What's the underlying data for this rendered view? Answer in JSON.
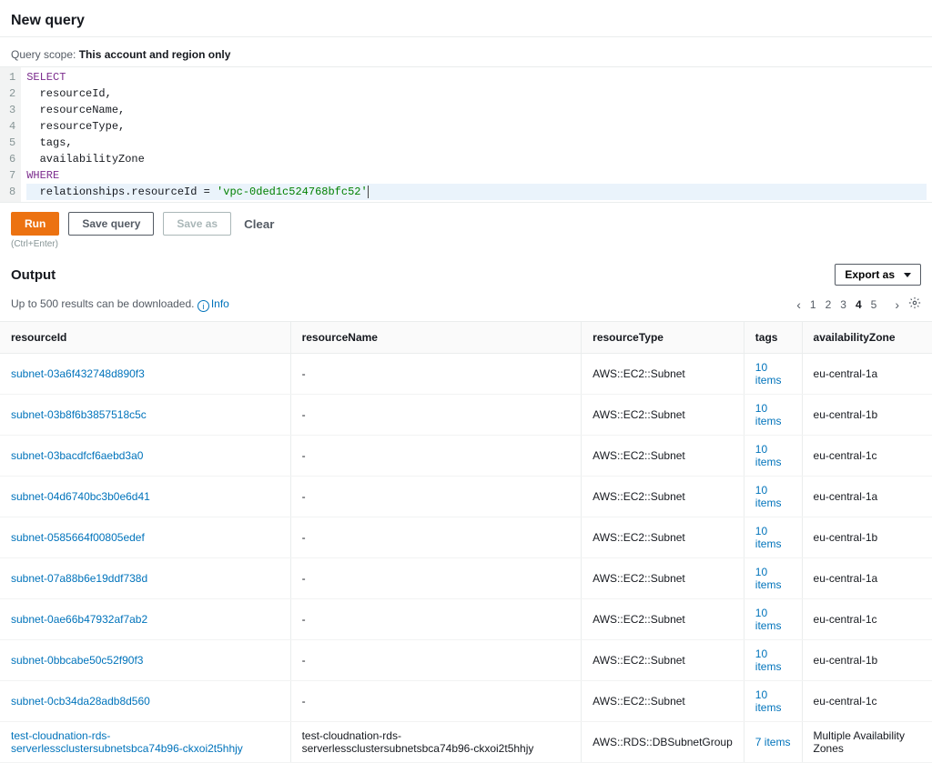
{
  "header": {
    "title": "New query"
  },
  "queryScope": {
    "label": "Query scope:",
    "value": "This account and region only"
  },
  "editor": {
    "lines": [
      {
        "n": 1,
        "tokens": [
          {
            "t": "SELECT",
            "c": "kw"
          }
        ]
      },
      {
        "n": 2,
        "tokens": [
          {
            "t": "  resourceId,",
            "c": "ident"
          }
        ]
      },
      {
        "n": 3,
        "tokens": [
          {
            "t": "  resourceName,",
            "c": "ident"
          }
        ]
      },
      {
        "n": 4,
        "tokens": [
          {
            "t": "  resourceType,",
            "c": "ident"
          }
        ]
      },
      {
        "n": 5,
        "tokens": [
          {
            "t": "  tags,",
            "c": "ident"
          }
        ]
      },
      {
        "n": 6,
        "tokens": [
          {
            "t": "  availabilityZone",
            "c": "ident"
          }
        ]
      },
      {
        "n": 7,
        "tokens": [
          {
            "t": "WHERE",
            "c": "kw"
          }
        ]
      },
      {
        "n": 8,
        "tokens": [
          {
            "t": "  relationships.resourceId ",
            "c": "ident"
          },
          {
            "t": "=",
            "c": "op"
          },
          {
            "t": " ",
            "c": "ident"
          },
          {
            "t": "'vpc-0ded1c524768bfc52'",
            "c": "str"
          }
        ],
        "active": true
      }
    ]
  },
  "buttons": {
    "run": "Run",
    "save": "Save query",
    "saveAs": "Save as",
    "clear": "Clear",
    "shortcut": "(Ctrl+Enter)",
    "export": "Export as"
  },
  "output": {
    "title": "Output",
    "resultsInfo": "Up to 500 results can be downloaded.",
    "infoLabel": "Info",
    "pagination": {
      "pages": [
        1,
        2,
        3,
        4,
        5
      ],
      "current": 4
    },
    "columns": [
      "resourceId",
      "resourceName",
      "resourceType",
      "tags",
      "availabilityZone"
    ],
    "rows": [
      {
        "resourceId": "subnet-03a6f432748d890f3",
        "resourceName": "-",
        "resourceType": "AWS::EC2::Subnet",
        "tags": "10 items",
        "availabilityZone": "eu-central-1a"
      },
      {
        "resourceId": "subnet-03b8f6b3857518c5c",
        "resourceName": "-",
        "resourceType": "AWS::EC2::Subnet",
        "tags": "10 items",
        "availabilityZone": "eu-central-1b"
      },
      {
        "resourceId": "subnet-03bacdfcf6aebd3a0",
        "resourceName": "-",
        "resourceType": "AWS::EC2::Subnet",
        "tags": "10 items",
        "availabilityZone": "eu-central-1c"
      },
      {
        "resourceId": "subnet-04d6740bc3b0e6d41",
        "resourceName": "-",
        "resourceType": "AWS::EC2::Subnet",
        "tags": "10 items",
        "availabilityZone": "eu-central-1a"
      },
      {
        "resourceId": "subnet-0585664f00805edef",
        "resourceName": "-",
        "resourceType": "AWS::EC2::Subnet",
        "tags": "10 items",
        "availabilityZone": "eu-central-1b"
      },
      {
        "resourceId": "subnet-07a88b6e19ddf738d",
        "resourceName": "-",
        "resourceType": "AWS::EC2::Subnet",
        "tags": "10 items",
        "availabilityZone": "eu-central-1a"
      },
      {
        "resourceId": "subnet-0ae66b47932af7ab2",
        "resourceName": "-",
        "resourceType": "AWS::EC2::Subnet",
        "tags": "10 items",
        "availabilityZone": "eu-central-1c"
      },
      {
        "resourceId": "subnet-0bbcabe50c52f90f3",
        "resourceName": "-",
        "resourceType": "AWS::EC2::Subnet",
        "tags": "10 items",
        "availabilityZone": "eu-central-1b"
      },
      {
        "resourceId": "subnet-0cb34da28adb8d560",
        "resourceName": "-",
        "resourceType": "AWS::EC2::Subnet",
        "tags": "10 items",
        "availabilityZone": "eu-central-1c"
      },
      {
        "resourceId": "test-cloudnation-rds-serverlessclustersubnetsbca74b96-ckxoi2t5hhjy",
        "resourceName": "test-cloudnation-rds-serverlessclustersubnetsbca74b96-ckxoi2t5hhjy",
        "resourceType": "AWS::RDS::DBSubnetGroup",
        "tags": "7 items",
        "availabilityZone": "Multiple Availability Zones"
      }
    ]
  }
}
